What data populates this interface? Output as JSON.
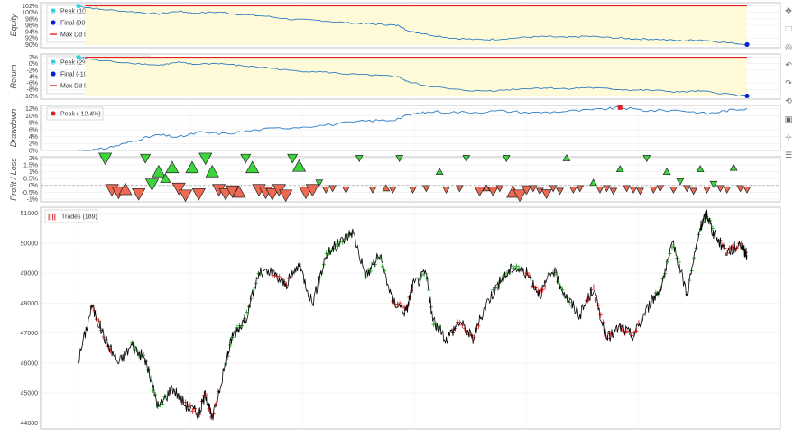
{
  "chart_data": [
    {
      "type": "area",
      "name": "equity",
      "ylabel": "Equity",
      "y_ticks": [
        "102%",
        "100%",
        "98%",
        "96%",
        "94%",
        "92%",
        "90%"
      ],
      "ylim": [
        89,
        103
      ],
      "legend": [
        "Peak (102%)",
        "Final (90%)",
        "Max Dd Dur. (19 days 10:45:00)"
      ],
      "peak": 102,
      "final": 90,
      "series_points": [
        [
          0,
          102
        ],
        [
          0.03,
          101
        ],
        [
          0.08,
          100.2
        ],
        [
          0.12,
          99.5
        ],
        [
          0.15,
          100.4
        ],
        [
          0.17,
          99.8
        ],
        [
          0.21,
          100.1
        ],
        [
          0.24,
          99.4
        ],
        [
          0.28,
          98.8
        ],
        [
          0.32,
          97.8
        ],
        [
          0.36,
          97.5
        ],
        [
          0.4,
          96.8
        ],
        [
          0.43,
          96.5
        ],
        [
          0.46,
          96.2
        ],
        [
          0.48,
          95.9
        ],
        [
          0.49,
          94.5
        ],
        [
          0.52,
          93.2
        ],
        [
          0.56,
          92
        ],
        [
          0.6,
          91.5
        ],
        [
          0.63,
          91.7
        ],
        [
          0.67,
          92.3
        ],
        [
          0.7,
          92.5
        ],
        [
          0.73,
          92.2
        ],
        [
          0.76,
          92.6
        ],
        [
          0.8,
          92.1
        ],
        [
          0.83,
          91.8
        ],
        [
          0.86,
          91.7
        ],
        [
          0.9,
          91.2
        ],
        [
          0.93,
          91.5
        ],
        [
          0.97,
          90.6
        ],
        [
          1,
          90
        ]
      ]
    },
    {
      "type": "area",
      "name": "return",
      "ylabel": "Return",
      "y_ticks": [
        "2%",
        "0%",
        "-2%",
        "-4%",
        "-6%",
        "-8%",
        "-10%"
      ],
      "ylim": [
        -11,
        3
      ],
      "legend": [
        "Peak (2%)",
        "Final (-10%)",
        "Max Dd Dur. (19 days 10:45:00)"
      ],
      "peak": 2,
      "final": -10,
      "series_points": [
        [
          0,
          2
        ],
        [
          0.03,
          1
        ],
        [
          0.08,
          0.2
        ],
        [
          0.12,
          -0.5
        ],
        [
          0.15,
          0.4
        ],
        [
          0.17,
          -0.2
        ],
        [
          0.21,
          0.1
        ],
        [
          0.24,
          -0.6
        ],
        [
          0.28,
          -1.2
        ],
        [
          0.32,
          -2.2
        ],
        [
          0.36,
          -2.5
        ],
        [
          0.4,
          -3.2
        ],
        [
          0.43,
          -3.5
        ],
        [
          0.46,
          -3.8
        ],
        [
          0.48,
          -4.1
        ],
        [
          0.49,
          -5.5
        ],
        [
          0.52,
          -6.8
        ],
        [
          0.56,
          -8
        ],
        [
          0.6,
          -8.5
        ],
        [
          0.63,
          -8.3
        ],
        [
          0.67,
          -7.7
        ],
        [
          0.7,
          -7.5
        ],
        [
          0.73,
          -7.8
        ],
        [
          0.76,
          -7.4
        ],
        [
          0.8,
          -7.9
        ],
        [
          0.83,
          -8.2
        ],
        [
          0.86,
          -8.3
        ],
        [
          0.9,
          -8.8
        ],
        [
          0.93,
          -8.5
        ],
        [
          0.97,
          -9.4
        ],
        [
          1,
          -10
        ]
      ]
    },
    {
      "type": "line",
      "name": "drawdown",
      "ylabel": "Drawdown",
      "y_ticks": [
        "12%",
        "10%",
        "8%",
        "6%",
        "4%",
        "2%",
        "0%"
      ],
      "ylim": [
        0,
        13
      ],
      "legend": [
        "Peak (-12.4%)"
      ],
      "peak": 12.4,
      "peak_at": 0.81,
      "series_points": [
        [
          0,
          0
        ],
        [
          0.03,
          0.2
        ],
        [
          0.06,
          1.5
        ],
        [
          0.09,
          3.2
        ],
        [
          0.12,
          4.5
        ],
        [
          0.15,
          3.8
        ],
        [
          0.18,
          5.2
        ],
        [
          0.22,
          4.8
        ],
        [
          0.27,
          6.0
        ],
        [
          0.33,
          6.8
        ],
        [
          0.38,
          7.5
        ],
        [
          0.43,
          8.5
        ],
        [
          0.47,
          8.8
        ],
        [
          0.5,
          10.5
        ],
        [
          0.53,
          11.2
        ],
        [
          0.58,
          11.0
        ],
        [
          0.63,
          11.4
        ],
        [
          0.68,
          10.9
        ],
        [
          0.73,
          11.3
        ],
        [
          0.78,
          11.8
        ],
        [
          0.81,
          12.4
        ],
        [
          0.85,
          11.5
        ],
        [
          0.9,
          11.6
        ],
        [
          0.94,
          10.6
        ],
        [
          0.97,
          11.5
        ],
        [
          1,
          12.2
        ]
      ]
    },
    {
      "type": "scatter",
      "name": "profit-loss",
      "ylabel": "Profit / Loss",
      "y_ticks": [
        "2%",
        "1.5%",
        "1%",
        "0.5%",
        "0%",
        "-0.5%",
        "-1%"
      ],
      "ylim": [
        -1.2,
        2.1
      ],
      "colors": {
        "win": "#3cd63c",
        "loss": "#ef6a53"
      },
      "trades": [
        [
          0.04,
          2.0,
          "v",
          3
        ],
        [
          0.05,
          -0.3,
          "v",
          3
        ],
        [
          0.06,
          -0.5,
          "v",
          3
        ],
        [
          0.07,
          -0.3,
          "^",
          3
        ],
        [
          0.09,
          -0.6,
          "v",
          3
        ],
        [
          0.1,
          2.0,
          "v",
          2
        ],
        [
          0.11,
          0.1,
          "v",
          3
        ],
        [
          0.12,
          1.0,
          "^",
          3
        ],
        [
          0.13,
          0.5,
          "^",
          2
        ],
        [
          0.14,
          1.3,
          "^",
          3
        ],
        [
          0.15,
          -0.2,
          "v",
          3
        ],
        [
          0.16,
          -0.7,
          "v",
          3
        ],
        [
          0.17,
          1.3,
          "^",
          3
        ],
        [
          0.18,
          -0.6,
          "v",
          3
        ],
        [
          0.19,
          2.0,
          "v",
          3
        ],
        [
          0.2,
          1.0,
          "^",
          3
        ],
        [
          0.21,
          -0.3,
          "v",
          3
        ],
        [
          0.22,
          -0.6,
          "v",
          3
        ],
        [
          0.23,
          -0.4,
          "v",
          3
        ],
        [
          0.24,
          -0.5,
          "^",
          3
        ],
        [
          0.25,
          2.0,
          "v",
          2
        ],
        [
          0.26,
          1.3,
          "^",
          3
        ],
        [
          0.27,
          -0.3,
          "v",
          3
        ],
        [
          0.28,
          -0.5,
          "v",
          3
        ],
        [
          0.29,
          -0.6,
          "v",
          3
        ],
        [
          0.3,
          -0.3,
          "v",
          3
        ],
        [
          0.31,
          -0.7,
          "v",
          3
        ],
        [
          0.32,
          2.0,
          "v",
          2
        ],
        [
          0.33,
          1.4,
          "^",
          3
        ],
        [
          0.34,
          -0.5,
          "v",
          3
        ],
        [
          0.35,
          -0.3,
          "v",
          3
        ],
        [
          0.36,
          0.2,
          "v",
          1
        ],
        [
          0.37,
          -0.3,
          "v",
          1
        ],
        [
          0.38,
          -0.2,
          "v",
          1
        ],
        [
          0.4,
          -0.3,
          "v",
          1
        ],
        [
          0.42,
          2.0,
          "v",
          1
        ],
        [
          0.44,
          -0.3,
          "v",
          1
        ],
        [
          0.46,
          -0.2,
          "^",
          1
        ],
        [
          0.47,
          -0.3,
          "v",
          1
        ],
        [
          0.48,
          2.0,
          "v",
          1
        ],
        [
          0.5,
          -0.3,
          "v",
          1
        ],
        [
          0.52,
          -0.2,
          "v",
          1
        ],
        [
          0.54,
          1.0,
          "^",
          1
        ],
        [
          0.55,
          -0.3,
          "v",
          1
        ],
        [
          0.57,
          -0.2,
          "v",
          1
        ],
        [
          0.58,
          2.0,
          "v",
          1
        ],
        [
          0.6,
          -0.4,
          "v",
          2
        ],
        [
          0.61,
          -0.2,
          "^",
          1
        ],
        [
          0.62,
          -0.4,
          "v",
          2
        ],
        [
          0.63,
          -0.2,
          "v",
          1
        ],
        [
          0.64,
          2.0,
          "v",
          1
        ],
        [
          0.65,
          -0.5,
          "^",
          3
        ],
        [
          0.66,
          -0.7,
          "v",
          3
        ],
        [
          0.67,
          -0.3,
          "v",
          2
        ],
        [
          0.68,
          -0.2,
          "v",
          1
        ],
        [
          0.69,
          -0.4,
          "v",
          1
        ],
        [
          0.7,
          -0.6,
          "v",
          2
        ],
        [
          0.71,
          -0.2,
          "v",
          1
        ],
        [
          0.72,
          -0.4,
          "v",
          1
        ],
        [
          0.73,
          2.0,
          "^",
          1
        ],
        [
          0.74,
          -0.3,
          "v",
          1
        ],
        [
          0.75,
          -0.2,
          "v",
          1
        ],
        [
          0.77,
          0.2,
          "^",
          1
        ],
        [
          0.78,
          -0.3,
          "v",
          1
        ],
        [
          0.79,
          -0.2,
          "v",
          1
        ],
        [
          0.8,
          -0.4,
          "v",
          1
        ],
        [
          0.81,
          1.2,
          "^",
          1
        ],
        [
          0.82,
          -0.2,
          "v",
          1
        ],
        [
          0.83,
          -0.3,
          "v",
          1
        ],
        [
          0.84,
          -0.4,
          "v",
          1
        ],
        [
          0.85,
          2.0,
          "v",
          1
        ],
        [
          0.86,
          -0.3,
          "v",
          1
        ],
        [
          0.87,
          -0.2,
          "v",
          1
        ],
        [
          0.88,
          1.0,
          "^",
          1
        ],
        [
          0.89,
          -0.3,
          "v",
          1
        ],
        [
          0.9,
          0.3,
          "v",
          1
        ],
        [
          0.91,
          -0.2,
          "v",
          1
        ],
        [
          0.92,
          -0.4,
          "v",
          1
        ],
        [
          0.93,
          1.2,
          "^",
          1
        ],
        [
          0.94,
          -0.3,
          "v",
          1
        ],
        [
          0.95,
          0.1,
          "v",
          1
        ],
        [
          0.96,
          -0.2,
          "v",
          1
        ],
        [
          0.97,
          -0.3,
          "v",
          1
        ],
        [
          0.98,
          1.3,
          "^",
          1
        ],
        [
          0.99,
          -0.2,
          "v",
          1
        ],
        [
          1.0,
          -0.3,
          "v",
          1
        ]
      ]
    },
    {
      "type": "line",
      "name": "price",
      "y_ticks": [
        "51000",
        "50000",
        "49000",
        "48000",
        "47000",
        "46000",
        "45000",
        "44000"
      ],
      "ylim": [
        43800,
        51200
      ],
      "legend": [
        "Trades (189)"
      ],
      "colors": {
        "price": "#000000",
        "long": "#2ca02c",
        "short": "#d62728"
      },
      "anchors": [
        [
          0,
          46100
        ],
        [
          0.02,
          47900
        ],
        [
          0.04,
          46800
        ],
        [
          0.06,
          46000
        ],
        [
          0.08,
          46600
        ],
        [
          0.1,
          46100
        ],
        [
          0.12,
          44500
        ],
        [
          0.14,
          45200
        ],
        [
          0.16,
          44600
        ],
        [
          0.18,
          44300
        ],
        [
          0.19,
          45000
        ],
        [
          0.2,
          44100
        ],
        [
          0.22,
          46000
        ],
        [
          0.23,
          46900
        ],
        [
          0.25,
          47500
        ],
        [
          0.27,
          49000
        ],
        [
          0.29,
          49000
        ],
        [
          0.31,
          48600
        ],
        [
          0.33,
          49300
        ],
        [
          0.35,
          48000
        ],
        [
          0.37,
          49600
        ],
        [
          0.39,
          50000
        ],
        [
          0.41,
          50400
        ],
        [
          0.43,
          48900
        ],
        [
          0.45,
          49600
        ],
        [
          0.47,
          48100
        ],
        [
          0.49,
          47700
        ],
        [
          0.5,
          48600
        ],
        [
          0.52,
          49000
        ],
        [
          0.53,
          47400
        ],
        [
          0.55,
          46800
        ],
        [
          0.57,
          47400
        ],
        [
          0.59,
          46800
        ],
        [
          0.61,
          48000
        ],
        [
          0.63,
          48700
        ],
        [
          0.65,
          49200
        ],
        [
          0.67,
          49000
        ],
        [
          0.69,
          48300
        ],
        [
          0.71,
          49100
        ],
        [
          0.73,
          48200
        ],
        [
          0.75,
          47600
        ],
        [
          0.77,
          48500
        ],
        [
          0.79,
          46800
        ],
        [
          0.81,
          47200
        ],
        [
          0.83,
          46900
        ],
        [
          0.85,
          47800
        ],
        [
          0.87,
          48500
        ],
        [
          0.89,
          50000
        ],
        [
          0.91,
          48300
        ],
        [
          0.93,
          50500
        ],
        [
          0.94,
          51000
        ],
        [
          0.95,
          50300
        ],
        [
          0.97,
          49700
        ],
        [
          0.99,
          50000
        ],
        [
          1,
          49600
        ]
      ],
      "trend_ranges": [
        [
          0.02,
          0.05,
          "short"
        ],
        [
          0.08,
          0.13,
          "long"
        ],
        [
          0.16,
          0.21,
          "short"
        ],
        [
          0.22,
          0.27,
          "long"
        ],
        [
          0.29,
          0.32,
          "short"
        ],
        [
          0.36,
          0.41,
          "long"
        ],
        [
          0.43,
          0.46,
          "long"
        ],
        [
          0.47,
          0.5,
          "short"
        ],
        [
          0.51,
          0.54,
          "long"
        ],
        [
          0.56,
          0.6,
          "short"
        ],
        [
          0.62,
          0.66,
          "long"
        ],
        [
          0.67,
          0.7,
          "short"
        ],
        [
          0.71,
          0.74,
          "long"
        ],
        [
          0.76,
          0.8,
          "short"
        ],
        [
          0.81,
          0.84,
          "short"
        ],
        [
          0.86,
          0.9,
          "long"
        ],
        [
          0.91,
          0.95,
          "long"
        ],
        [
          0.96,
          1.0,
          "short"
        ]
      ]
    }
  ],
  "toolbar": {
    "icons": [
      "pan-icon",
      "box-zoom-icon",
      "wheel-zoom-icon",
      "undo-icon",
      "redo-icon",
      "reset-icon",
      "save-icon",
      "crosshair-icon",
      "hover-icon"
    ]
  }
}
